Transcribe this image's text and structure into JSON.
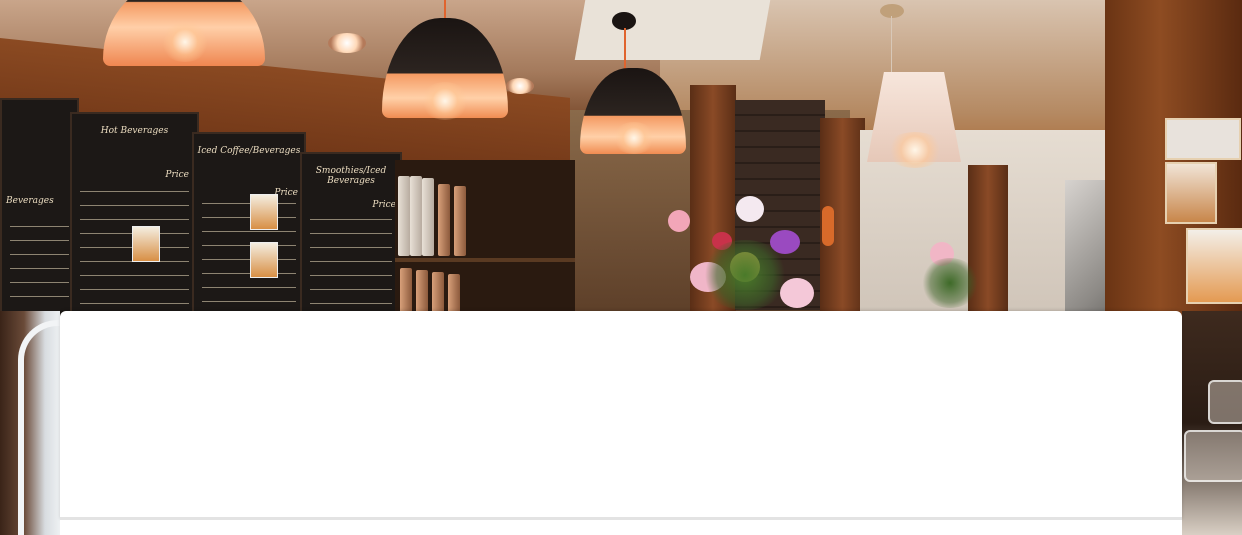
{
  "hero": {
    "alt": "",
    "menu_boards": {
      "hot_title": "Hot Beverages",
      "iced_title": "Iced Coffee/Beverages",
      "smoothie_title": "Smoothies/Iced Beverages",
      "left_title": "Beverages",
      "price_label": "Price"
    }
  },
  "card": {
    "title": "",
    "body": ""
  },
  "colors": {
    "card_background": "#ffffff",
    "card_border": "#e3e3e3"
  }
}
